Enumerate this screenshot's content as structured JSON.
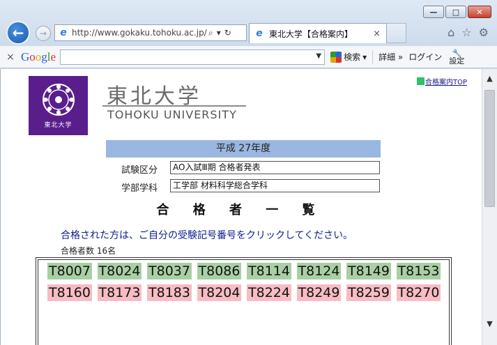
{
  "window": {
    "minimize": "—",
    "maximize": "□",
    "close": "✕"
  },
  "nav": {
    "back": "←",
    "forward": "→"
  },
  "address_bar": {
    "url": "http://www.gokaku.tohoku.ac.jp/",
    "search_glyph": "⌕",
    "dropdown_glyph": "▾",
    "refresh_glyph": "↻"
  },
  "tab": {
    "title": "東北大学【合格案内】",
    "close": "×"
  },
  "browser_icons": {
    "home": "⌂",
    "favorites": "☆",
    "settings": "⚙"
  },
  "google_toolbar": {
    "close": "×",
    "logo": [
      "G",
      "o",
      "o",
      "g",
      "l",
      "e"
    ],
    "search_label": "検索",
    "details_label": "詳細 »",
    "login_label": "ログイン",
    "settings_label": "設定"
  },
  "page": {
    "logo_caption": "東北大学",
    "university_jp": "東北大学",
    "university_en": "TOHOKU UNIVERSITY",
    "top_link": "合格案内TOP",
    "year": "平成 27年度",
    "fields": [
      {
        "label": "試験区分",
        "value": "AO入試Ⅲ期  合格者発表"
      },
      {
        "label": "学部学科",
        "value": "工学部  材料科学総合学科"
      }
    ],
    "list_title": "合 格 者 一 覧",
    "instruction": "合格された方は、ご自分の受験記号番号をクリックしてください。",
    "count": "合格者数  16名",
    "numbers_row1": [
      "T8007",
      "T8024",
      "T8037",
      "T8086",
      "T8114",
      "T8124",
      "T8149",
      "T8153"
    ],
    "numbers_row2": [
      "T8160",
      "T8173",
      "T8183",
      "T8204",
      "T8224",
      "T8249",
      "T8259",
      "T8270"
    ],
    "row_colors": [
      "#a9cfa4",
      "#f7bcc4"
    ]
  }
}
